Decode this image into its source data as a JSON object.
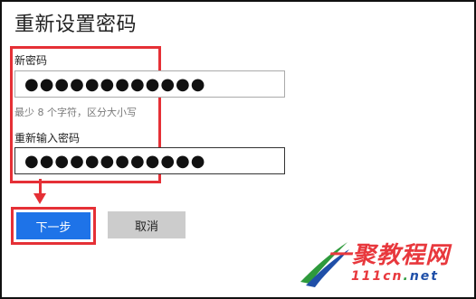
{
  "dialog": {
    "title": "重新设置密码"
  },
  "form": {
    "new_password": {
      "label": "新密码",
      "value": "●●●●●●●●●●●●",
      "hint": "最少 8 个字符，区分大小写"
    },
    "confirm_password": {
      "label": "重新输入密码",
      "value": "●●●●●●●●●●●●"
    }
  },
  "buttons": {
    "next_label": "下一步",
    "cancel_label": "取消"
  },
  "watermark": {
    "text": "一聚教程网",
    "url": "111cn.net"
  },
  "colors": {
    "accent_blue": "#1e73e8",
    "highlight_red": "#e53036",
    "cancel_gray": "#cccccc",
    "watermark_red": "#e8383d",
    "watermark_green": "#2e9a3c",
    "watermark_blue": "#1f4fa8"
  }
}
